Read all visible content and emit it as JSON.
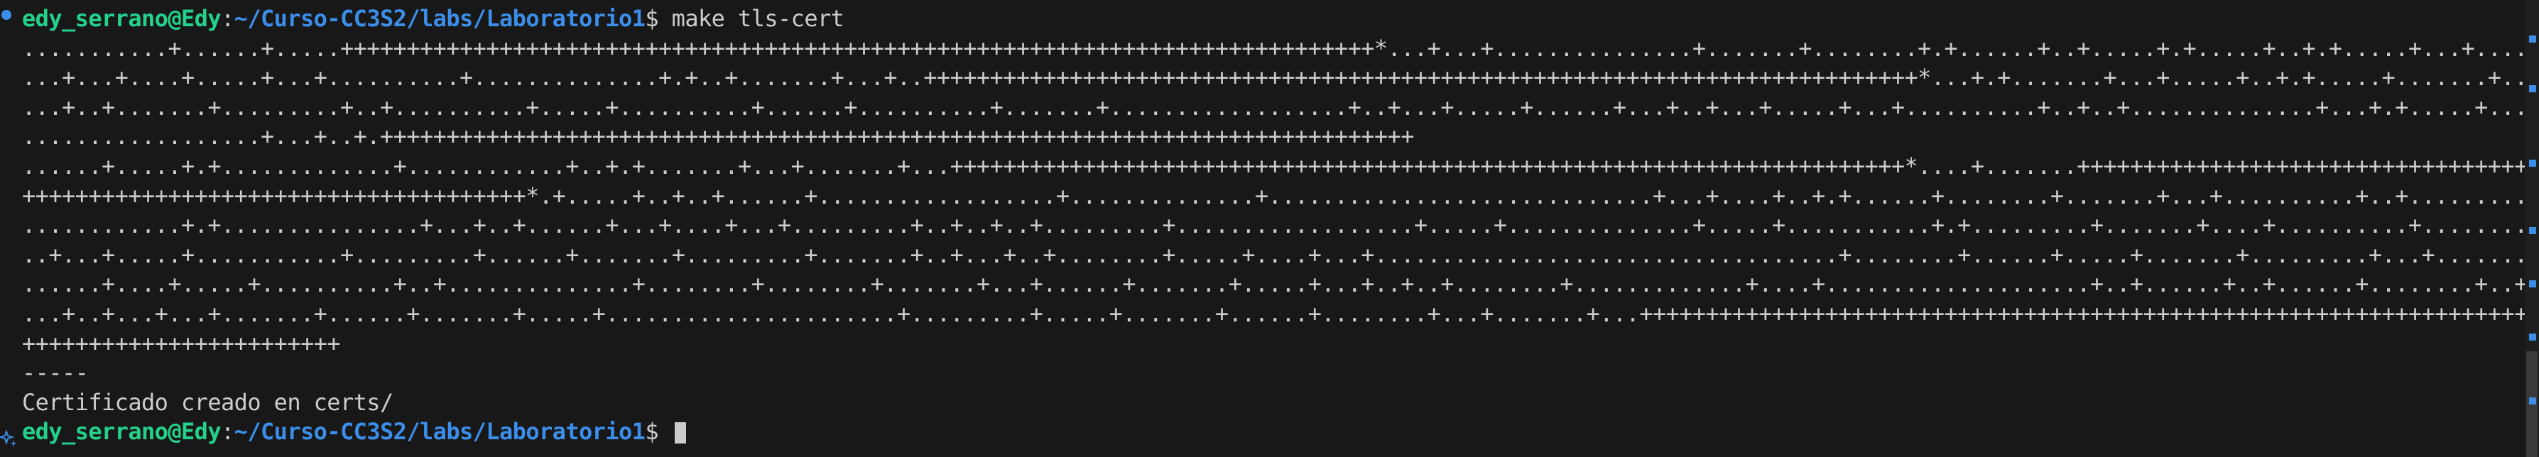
{
  "colors": {
    "background": "#181818",
    "text": "#cccccc",
    "user_host": "#23d18b",
    "path": "#3b8eea",
    "marker": "#3b8eea",
    "scrollbar_thumb": "#3a3a3a"
  },
  "prompt": {
    "user_host": "edy_serrano@Edy",
    "colon": ":",
    "path": "~/Curso-CC3S2/labs/Laboratorio1",
    "symbol": "$ ",
    "command": "make tls-cert"
  },
  "output_lines": [
    "...........+......+.....++++++++++++++++++++++++++++++++++++++++++++++++++++++++++++++++++++++++++++++*...+...+...............+.......+........+.+......+..+.....+.+.....+..+.+.....+...+....+.......",
    "...+...+....+.....+...+..........+..............+.+..+.......+...+..+++++++++++++++++++++++++++++++++++++++++++++++++++++++++++++++++++++++++++*...+.+.......+...+.....+..+.+.....+.......+......",
    "...+..+.......+.........+..+..........+.....+..........+......+..........+.......+..................+..+...+.....+......+...+..+...+.....+...+..........+..+..+..............+...+.+.....+....",
    "..................+...+..+.++++++++++++++++++++++++++++++++++++++++++++++++++++++++++++++++++++++++++++++",
    "......+.....+.+.............+............+..+.+.......+...+.......+...++++++++++++++++++++++++++++++++++++++++++++++++++++++++++++++++++++++++*....+.......+++++++++++++++++++++++++++++++++++++++",
    "++++++++++++++++++++++++++++++++++++++*.+.....+..+..+......+..................+..............+.............................+...+....+..+.+......+........+.......+...+..........+..+.........+...+",
    "............+.+...............+...+..+......+...+....+...+.........+..+..+..+.........+..................+.....+..............+.....+...........+.+.........+.......+....+..........+..........+",
    "..+...+.....+...........+.........+......+.......+.........+.......+..+...+..+........+.....+....+...+...................................+........+......+.....+.......+.........+...+........",
    "......+....+.....+..........+..+..............+........+........+.......+...+......+.......+.....+...+..+..+........+.............+....+....................+..+......+..+......+........+..+.",
    "...+..+...+...+.......+......+.......+.....+......................+.........+.....+.......+......+........+...+.......+...++++++++++++++++++++++++++++++++++++++++++++++++++++++++++++++++++++++",
    "++++++++++++++++++++++++",
    "-----",
    "Certificado creado en certs/"
  ]
}
